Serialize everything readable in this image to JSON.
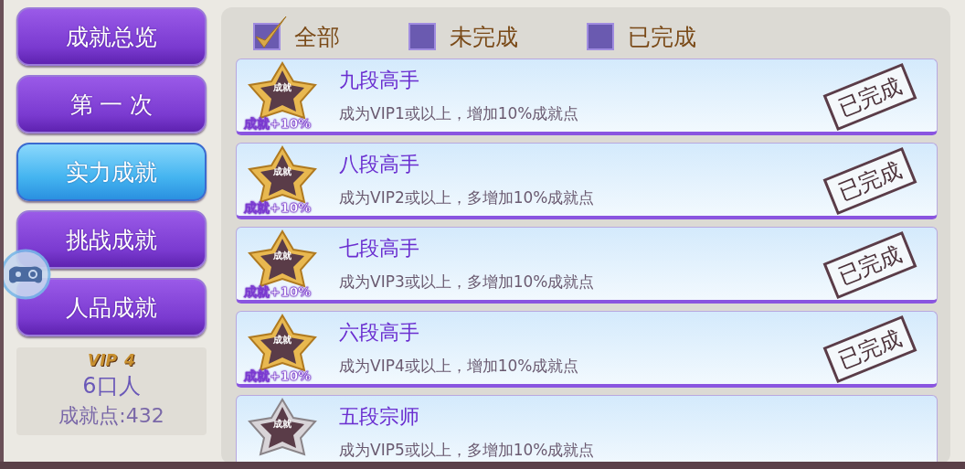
{
  "categories": [
    {
      "label": "成就总览",
      "selected": false
    },
    {
      "label": "第 一 次",
      "selected": false
    },
    {
      "label": "实力成就",
      "selected": true
    },
    {
      "label": "挑战成就",
      "selected": false
    },
    {
      "label": "人品成就",
      "selected": false
    }
  ],
  "profile": {
    "vip_label": "VIP",
    "vip_level": "4",
    "name": "6口人",
    "points": "成就点:432"
  },
  "filters": [
    {
      "label": "全部",
      "checked": true
    },
    {
      "label": "未完成",
      "checked": false
    },
    {
      "label": "已完成",
      "checked": false
    }
  ],
  "achievements": [
    {
      "kind": "gold",
      "emblem": "成就",
      "bonus": "成就+10%",
      "title": "九段高手",
      "description": "成为VIP1或以上，增加10%成就点",
      "completed": true,
      "stamp": "已完成"
    },
    {
      "kind": "gold",
      "emblem": "成就",
      "bonus": "成就+10%",
      "title": "八段高手",
      "description": "成为VIP2或以上，多增加10%成就点",
      "completed": true,
      "stamp": "已完成"
    },
    {
      "kind": "gold",
      "emblem": "成就",
      "bonus": "成就+10%",
      "title": "七段高手",
      "description": "成为VIP3或以上，多增加10%成就点",
      "completed": true,
      "stamp": "已完成"
    },
    {
      "kind": "gold",
      "emblem": "成就",
      "bonus": "成就+10%",
      "title": "六段高手",
      "description": "成为VIP4或以上，增加10%成就点",
      "completed": true,
      "stamp": "已完成"
    },
    {
      "kind": "silver",
      "emblem": "成就",
      "title": "五段宗师",
      "description": "成为VIP5或以上，多增加10%成就点",
      "completed": false
    }
  ]
}
